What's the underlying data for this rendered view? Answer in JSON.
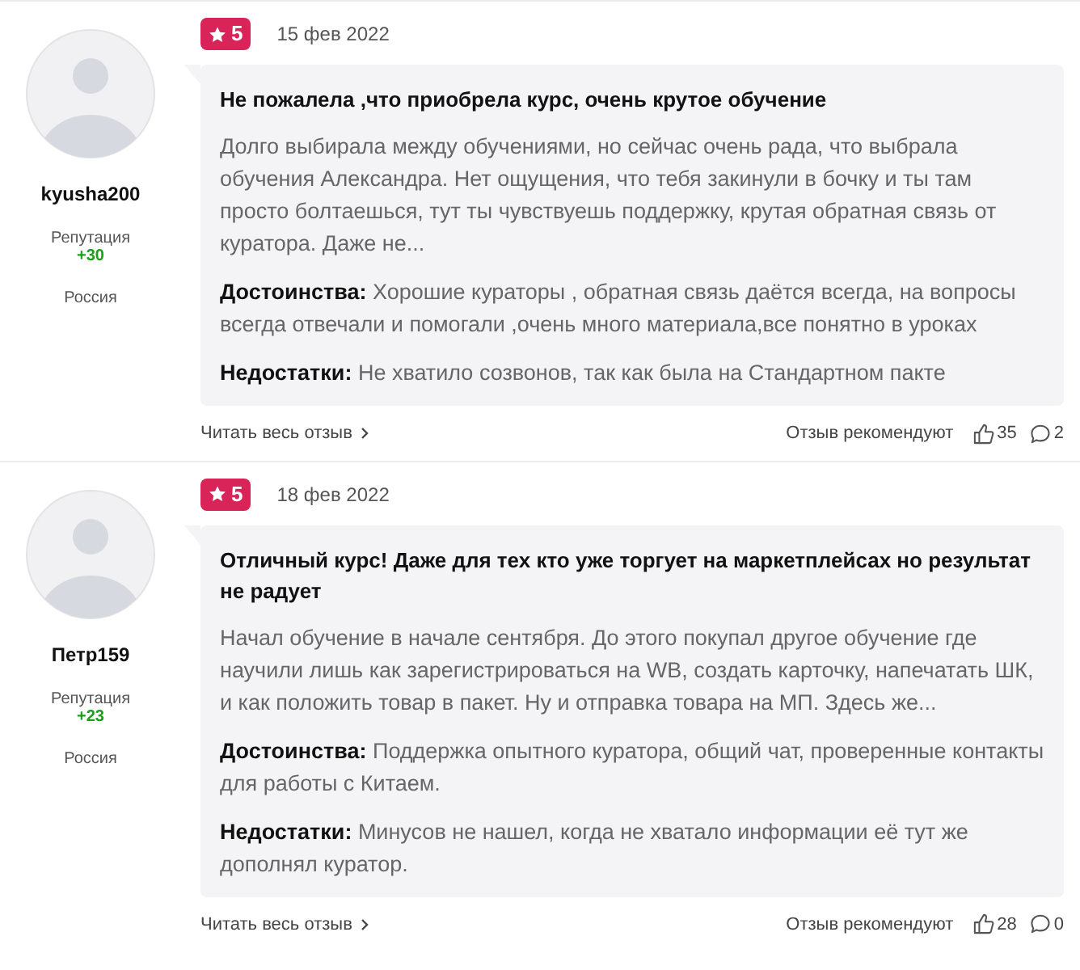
{
  "reviews": [
    {
      "author": "kyusha200",
      "reputation_label": "Репутация",
      "reputation": "+30",
      "country": "Россия",
      "rating": "5",
      "date": "15 фев 2022",
      "title": "Не пожалела ,что приобрела курс, очень крутое обучение",
      "text": "Долго выбирала между обучениями, но сейчас очень рада, что выбрала обучения Александра. Нет ощущения, что тебя закинули в бочку и ты там просто болтаешься, тут ты чувствуешь поддержку, крутая обратная связь от куратора. Даже не...",
      "pros": "**Достоинства:** Хорошие кураторы , обратная связь даётся всегда, на вопросы всегда отвечали и помогали ,очень много материала,все понятно в уроках",
      "cons": "**Недостатки:** Не хватило созвонов, так как была на Стандартном пакте",
      "read_more": "Читать весь отзыв",
      "recommend_label": "Отзыв рекомендуют",
      "likes": "35",
      "comments": "2"
    },
    {
      "author": "Петр159",
      "reputation_label": "Репутация",
      "reputation": "+23",
      "country": "Россия",
      "rating": "5",
      "date": "18 фев 2022",
      "title": "Отличный курс! Даже для тех кто уже торгует на маркетплейсах но результат не радует",
      "text": "Начал обучение в начале сентября. До этого покупал другое обучение где научили лишь как зарегистрироваться на WB, создать карточку, напечатать ШК, и как положить товар в пакет. Ну и отправка товара на МП. Здесь же...",
      "pros": "**Достоинства:** Поддержка опытного куратора, общий чат, проверенные контакты для работы с Китаем.",
      "cons": "**Недостатки:** Минусов не нашел, когда не хватало информации её тут же дополнял куратор.",
      "read_more": "Читать весь отзыв",
      "recommend_label": "Отзыв рекомендуют",
      "likes": "28",
      "comments": "0"
    }
  ]
}
